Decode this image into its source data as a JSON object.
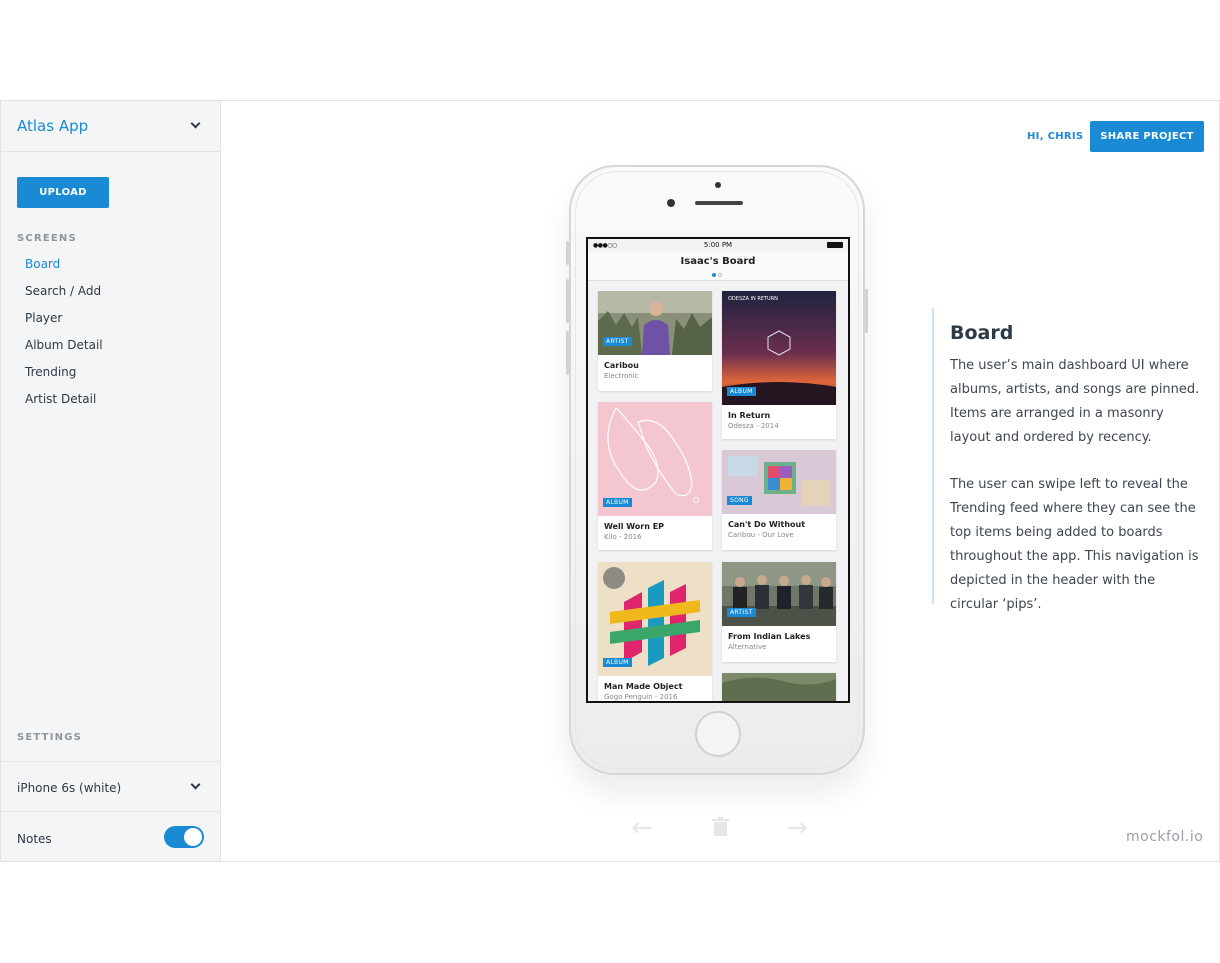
{
  "sidebar": {
    "app_name": "Atlas App",
    "upload_label": "UPLOAD",
    "screens_label": "SCREENS",
    "screens": [
      "Board",
      "Search / Add",
      "Player",
      "Album Detail",
      "Trending",
      "Artist Detail"
    ],
    "active_screen": "Board",
    "settings_label": "SETTINGS",
    "device": "iPhone 6s (white)",
    "notes_label": "Notes",
    "notes_enabled": true
  },
  "header": {
    "greeting": "HI, CHRIS",
    "share_label": "SHARE PROJECT"
  },
  "phone": {
    "status_time": "5:00 PM",
    "signal": "●●●○○",
    "board_title": "Isaac's Board",
    "cards": [
      {
        "tag": "ARTIST",
        "title": "Caribou",
        "subtitle": "Electronic"
      },
      {
        "tag": "ALBUM",
        "title": "In Return",
        "subtitle": "Odesza - 2014",
        "art_text": "ODESZA IN RETURN"
      },
      {
        "tag": "ALBUM",
        "title": "Well Worn EP",
        "subtitle": "Kilo - 2016"
      },
      {
        "tag": "SONG",
        "title": "Can't Do Without",
        "subtitle": "Caribou - Our Love"
      },
      {
        "tag": "ALBUM",
        "title": "Man Made Object",
        "subtitle": "Gogo Penguin - 2016"
      },
      {
        "tag": "ARTIST",
        "title": "From Indian Lakes",
        "subtitle": "Alternative"
      }
    ]
  },
  "notes": {
    "title": "Board",
    "paragraph_1": "The user’s main dashboard UI where albums, artists, and songs are pinned. Items are arranged in a masonry layout and ordered by recency.",
    "paragraph_2": "The user can swipe left to reveal the Trending feed where they can see the top items being added to boards throughout the app. This navigation is depicted in the header with the circular ‘pips’."
  },
  "bottom_nav": {
    "prev_icon": "arrow-left-icon",
    "delete_icon": "trash-icon",
    "next_icon": "arrow-right-icon",
    "prev_glyph": "←",
    "next_glyph": "→"
  },
  "watermark": "mockfol.io",
  "colors": {
    "accent": "#1a8ad4",
    "sidebar_bg": "#f3f5f7",
    "text": "#2d3945"
  }
}
